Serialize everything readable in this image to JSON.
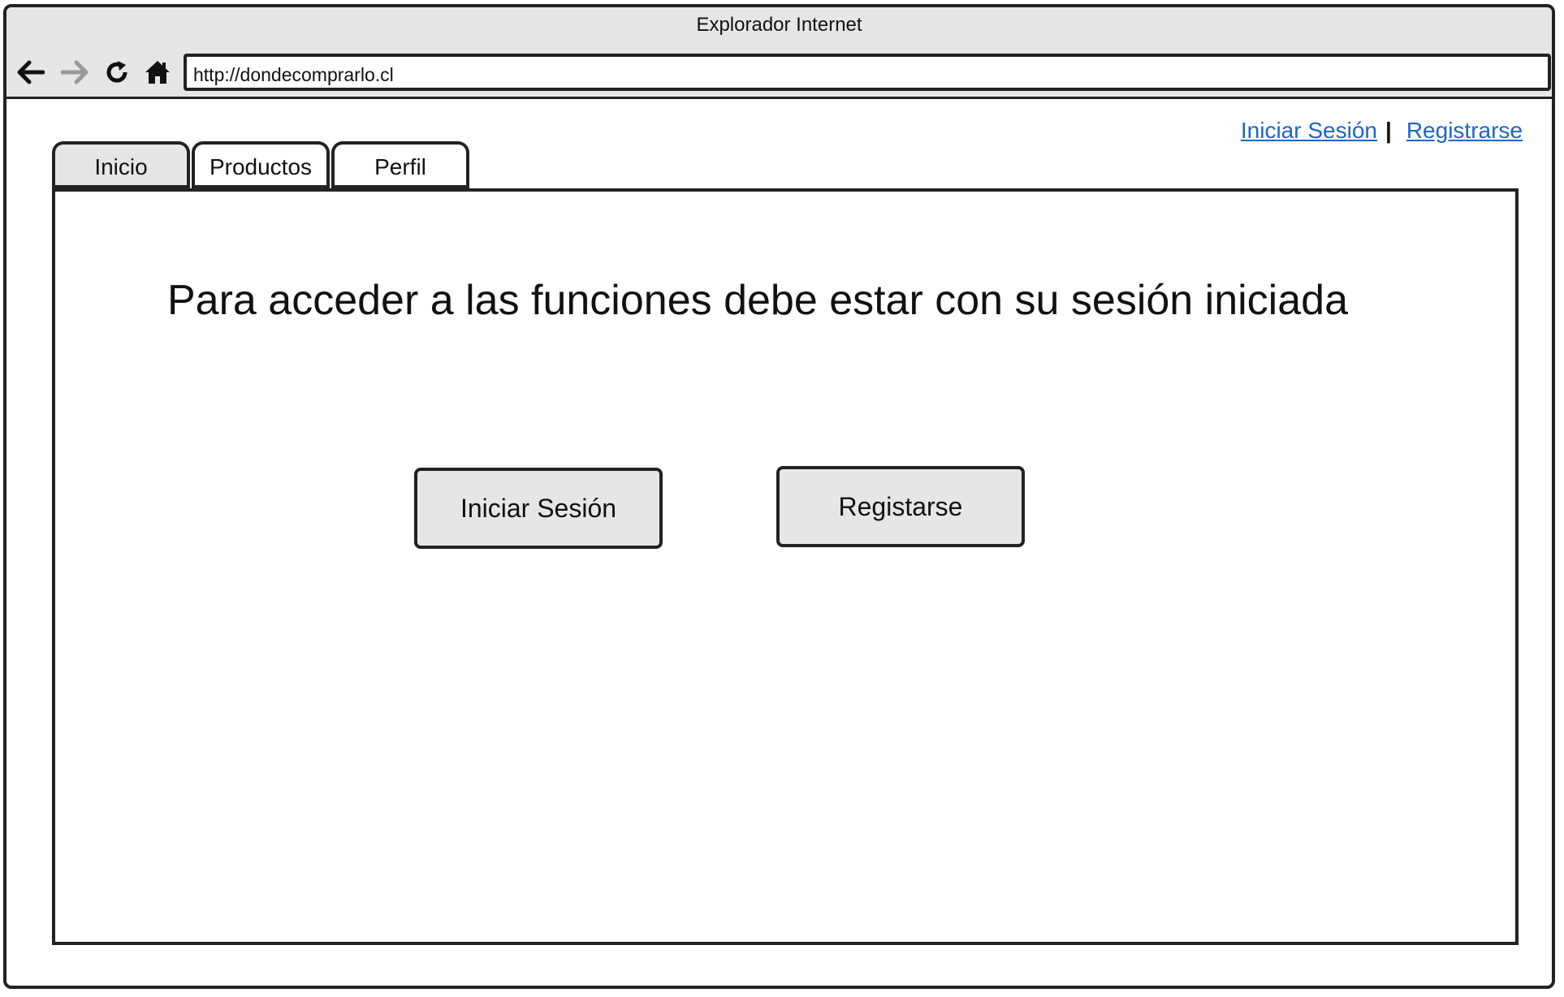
{
  "window": {
    "title": "Explorador Internet"
  },
  "toolbar": {
    "url": "http://dondecomprarlo.cl"
  },
  "header_links": {
    "login": "Iniciar Sesión",
    "separator": "|",
    "register": "Registrarse"
  },
  "tabs": [
    {
      "label": "Inicio",
      "active": true
    },
    {
      "label": "Productos",
      "active": false
    },
    {
      "label": "Perfil",
      "active": false
    }
  ],
  "main": {
    "message": "Para acceder a las funciones debe estar con su sesión iniciada",
    "login_button": "Iniciar Sesión",
    "register_button": "Registarse"
  },
  "colors": {
    "link": "#1a66cc",
    "chrome": "#e6e6e6",
    "border": "#222222"
  },
  "icons": {
    "back": "arrow-left-icon",
    "forward": "arrow-right-icon",
    "reload": "reload-icon",
    "home": "home-icon"
  }
}
